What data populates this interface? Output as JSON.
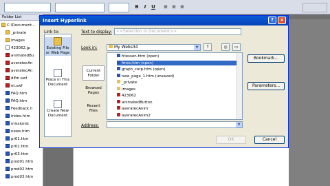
{
  "dialog": {
    "title": "Insert Hyperlink",
    "help_label": "?",
    "close_label": "×",
    "link_to_label": "Link to:",
    "text_to_display_label": "Text to display:",
    "text_to_display_value": "<<Selection in Document>>",
    "look_in_label": "Look in:",
    "look_in_value": "My Webs34",
    "address_label": "Address:",
    "address_value": "",
    "bookmark_label": "Bookmark...",
    "parameters_label": "Parameters...",
    "ok_label": "OK",
    "cancel_label": "Cancel"
  },
  "link_to": [
    {
      "label": "Existing File or Web Page"
    },
    {
      "label": "Place in This Document"
    },
    {
      "label": "Create New Document"
    }
  ],
  "look_side": [
    {
      "label": "Current Folder"
    },
    {
      "label": "Browsed Pages"
    },
    {
      "label": "Recent Files"
    }
  ],
  "files": [
    {
      "name": "frlessen.htm (open)"
    },
    {
      "name": "fmov.htm (open)"
    },
    {
      "name": "graph_corp.htm (open)"
    },
    {
      "name": "new_page_1.htm (unsaved)"
    },
    {
      "name": "_private"
    },
    {
      "name": "images"
    },
    {
      "name": "423062"
    },
    {
      "name": "animatedButton"
    },
    {
      "name": "averatecAnim"
    },
    {
      "name": "averatecAnim2"
    }
  ],
  "folder_list": {
    "header": "Folder List",
    "close": "×",
    "items": [
      {
        "name": "C:\\Document..."
      },
      {
        "name": "_private"
      },
      {
        "name": "images"
      },
      {
        "name": "423062.jp"
      },
      {
        "name": "animatedBu"
      },
      {
        "name": "averatecAn"
      },
      {
        "name": "averatecAn"
      },
      {
        "name": "dlfm.swf"
      },
      {
        "name": "et.swf"
      },
      {
        "name": "FAQ.htm"
      },
      {
        "name": "FAQ.htm"
      },
      {
        "name": "Feedback.h"
      },
      {
        "name": "index.htm"
      },
      {
        "name": "missionst"
      },
      {
        "name": "news.htm"
      },
      {
        "name": "pr01.htm"
      },
      {
        "name": "pr02.htm"
      },
      {
        "name": "pr03.htm"
      },
      {
        "name": "prod01.htm"
      },
      {
        "name": "prod02.htm"
      },
      {
        "name": "prod03.htm"
      }
    ]
  },
  "toolbar": {
    "buttons": [
      "B",
      "I",
      "U",
      "≡",
      "≡",
      "≡"
    ]
  }
}
